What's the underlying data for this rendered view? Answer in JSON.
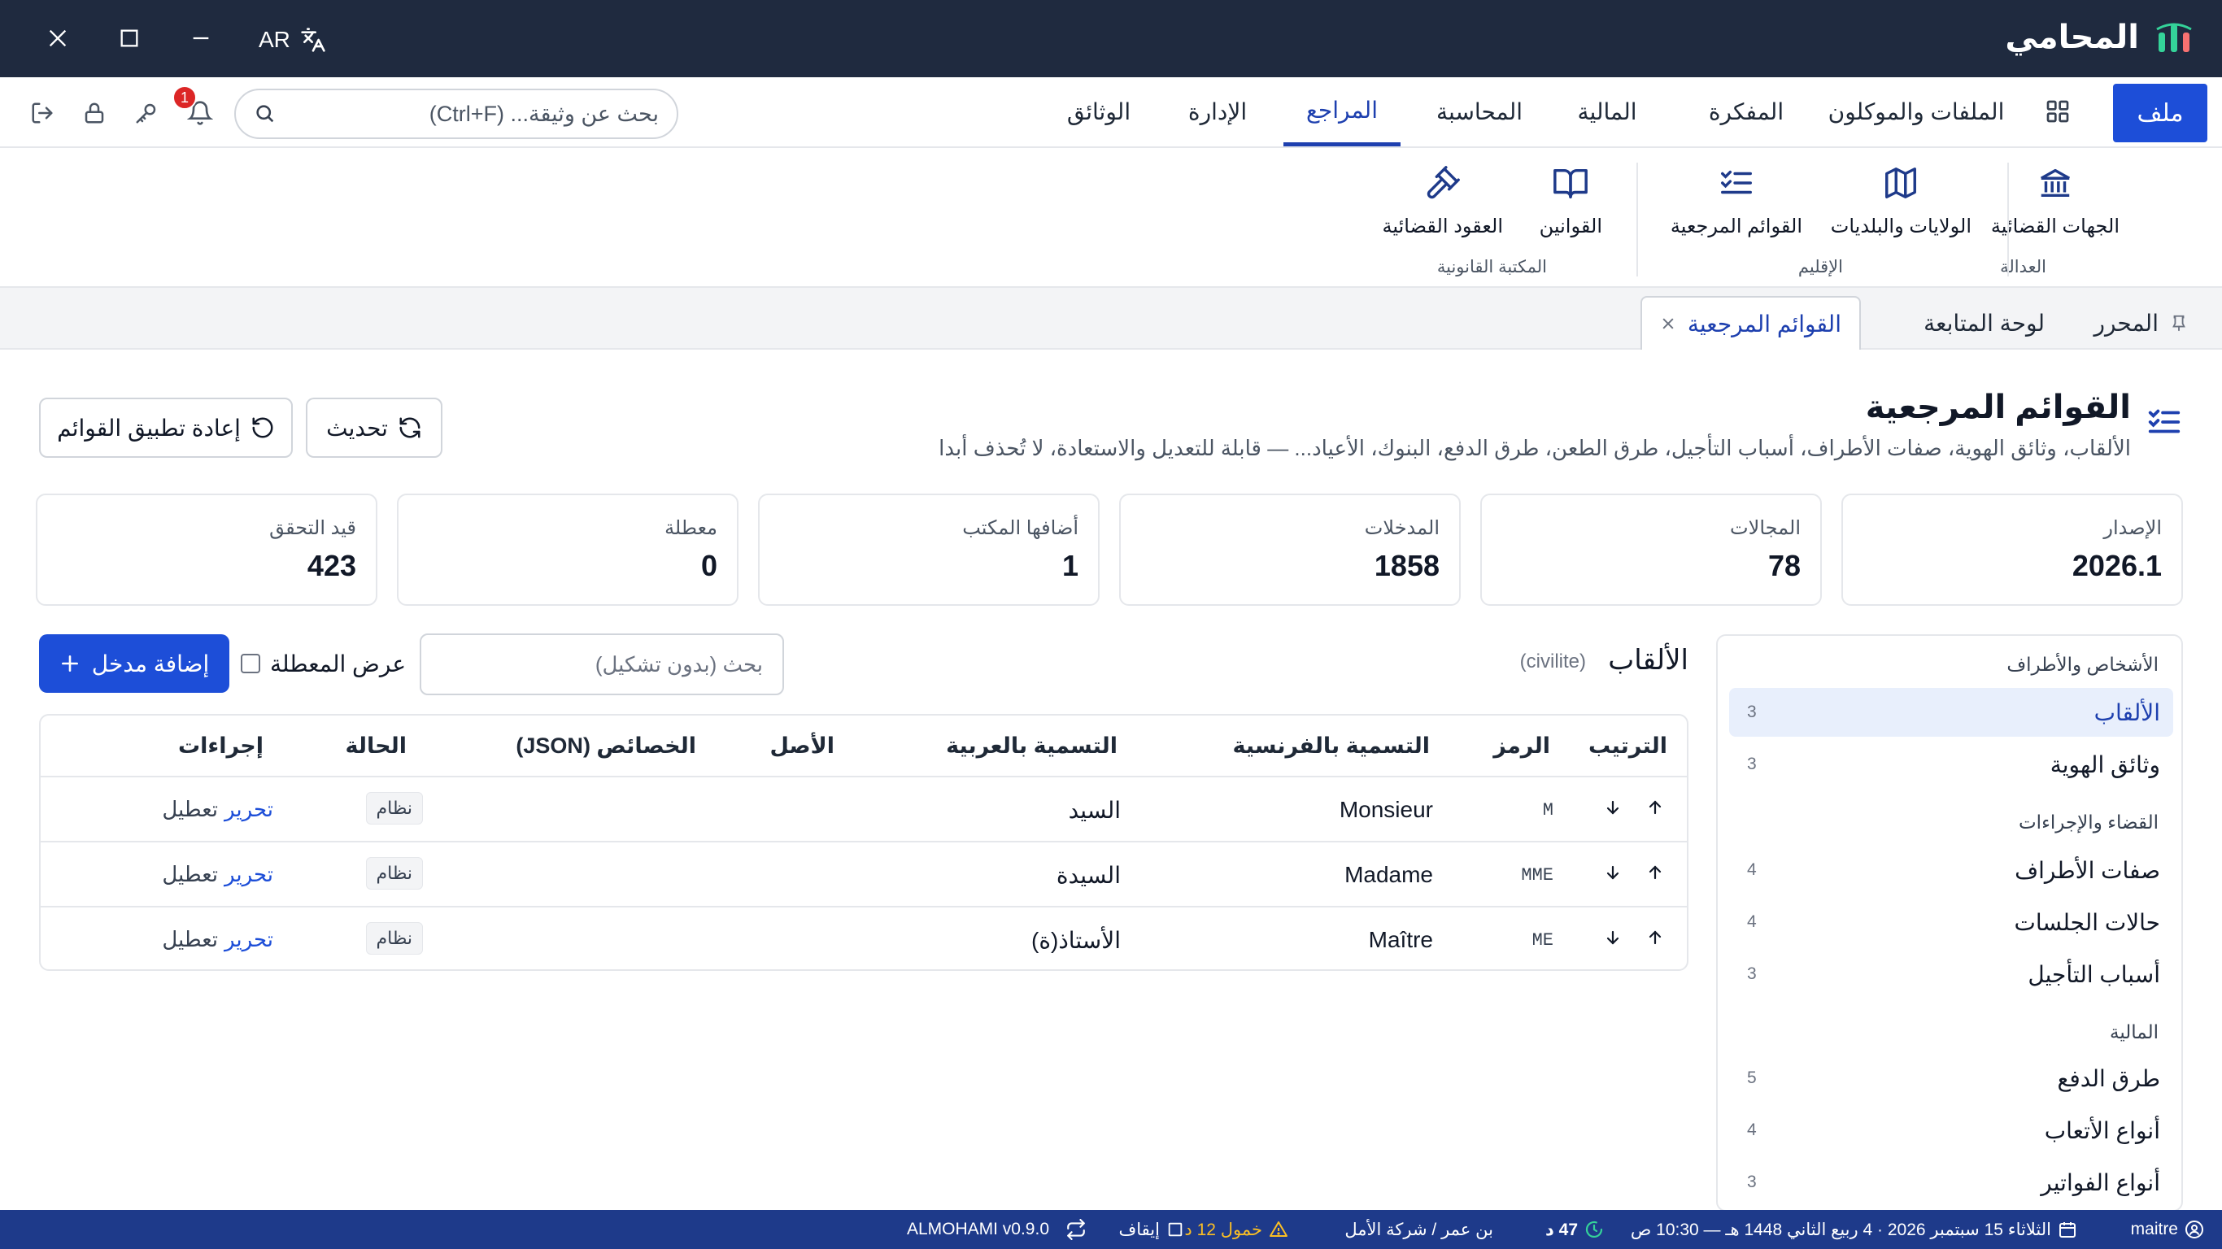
{
  "app": {
    "name": "المحامي",
    "version": "ALMOHAMI v0.9.0"
  },
  "titlebar": {
    "lang": "AR",
    "icons": [
      "logo-icon",
      "translate-icon",
      "minimize-icon",
      "maximize-icon",
      "close-icon"
    ]
  },
  "menubar": {
    "file": "ملف",
    "items": [
      "الملفات والموكلون",
      "المفكرة",
      "المالية",
      "المحاسبة",
      "المراجع",
      "الإدارة",
      "الوثائق"
    ],
    "active": "المراجع",
    "search_placeholder": "بحث عن وثيقة... (Ctrl+F)",
    "notification_count": "1"
  },
  "ribbon": {
    "groups": [
      {
        "label": "العدالة",
        "buttons": [
          "الجهات القضائية"
        ]
      },
      {
        "label": "الإقليم",
        "buttons": [
          "الولايات والبلديات",
          "القوائم المرجعية"
        ]
      },
      {
        "label": "المكتبة القانونية",
        "buttons": [
          "القوانين",
          "العقود القضائية"
        ]
      }
    ]
  },
  "tabs": {
    "pinned": "المحرر",
    "dashboard": "لوحة المتابعة",
    "active": "القوائم المرجعية"
  },
  "page": {
    "title": "القوائم المرجعية",
    "subtitle": "الألقاب، وثائق الهوية، صفات الأطراف، أسباب التأجيل، طرق الطعن، طرق الدفع، البنوك، الأعياد... — قابلة للتعديل والاستعادة، لا تُحذف أبدا",
    "refresh": "تحديث",
    "reapply": "إعادة تطبيق القوائم"
  },
  "stats": [
    {
      "label": "الإصدار",
      "value": "2026.1"
    },
    {
      "label": "المجالات",
      "value": "78"
    },
    {
      "label": "المدخلات",
      "value": "1858"
    },
    {
      "label": "أضافها المكتب",
      "value": "1"
    },
    {
      "label": "معطلة",
      "value": "0"
    },
    {
      "label": "قيد التحقق",
      "value": "423"
    }
  ],
  "sidebar": {
    "sections": [
      {
        "title": "الأشخاص والأطراف",
        "items": [
          {
            "label": "الألقاب",
            "count": "3",
            "active": true
          },
          {
            "label": "وثائق الهوية",
            "count": "3"
          }
        ]
      },
      {
        "title": "القضاء والإجراءات",
        "items": [
          {
            "label": "صفات الأطراف",
            "count": "4"
          },
          {
            "label": "حالات الجلسات",
            "count": "4"
          },
          {
            "label": "أسباب التأجيل",
            "count": "3"
          }
        ]
      },
      {
        "title": "المالية",
        "items": [
          {
            "label": "طرق الدفع",
            "count": "5"
          },
          {
            "label": "أنواع الأتعاب",
            "count": "4"
          },
          {
            "label": "أنواع الفواتير",
            "count": "3"
          }
        ]
      }
    ]
  },
  "list": {
    "title": "الألقاب",
    "code": "(civilite)",
    "search_placeholder": "بحث (بدون تشكيل)",
    "show_disabled": "عرض المعطلة",
    "add_button": "إضافة مدخل"
  },
  "table": {
    "headers": [
      "الترتيب",
      "الرمز",
      "التسمية بالفرنسية",
      "التسمية بالعربية",
      "الأصل",
      "الخصائص (JSON)",
      "الحالة",
      "إجراءات"
    ],
    "rows": [
      {
        "code": "M",
        "fr": "Monsieur",
        "ar": "السيد",
        "origin": "",
        "props": "",
        "status": "نظام",
        "edit": "تحرير",
        "disable": "تعطيل"
      },
      {
        "code": "MME",
        "fr": "Madame",
        "ar": "السيدة",
        "origin": "",
        "props": "",
        "status": "نظام",
        "edit": "تحرير",
        "disable": "تعطيل"
      },
      {
        "code": "ME",
        "fr": "Maître",
        "ar": "الأستاذ(ة)",
        "origin": "",
        "props": "",
        "status": "نظام",
        "edit": "تحرير",
        "disable": "تعطيل"
      }
    ]
  },
  "statusbar": {
    "user": "maitre",
    "date": "الثلاثاء 15 سبتمبر 2026 · 4 ربيع الثاني 1448 هـ — 10:30 ص",
    "timer": "47 د",
    "client": "بن عمر / شركة الأمل",
    "idle": "خمول 12 د",
    "pause": "إيقاف"
  },
  "colors": {
    "primary": "#1d4ed8",
    "titlebar": "#1f2a3f",
    "statusbar": "#1e3a8a",
    "accent": "#1e40af",
    "warning": "#fbbf24",
    "success": "#34d399"
  }
}
